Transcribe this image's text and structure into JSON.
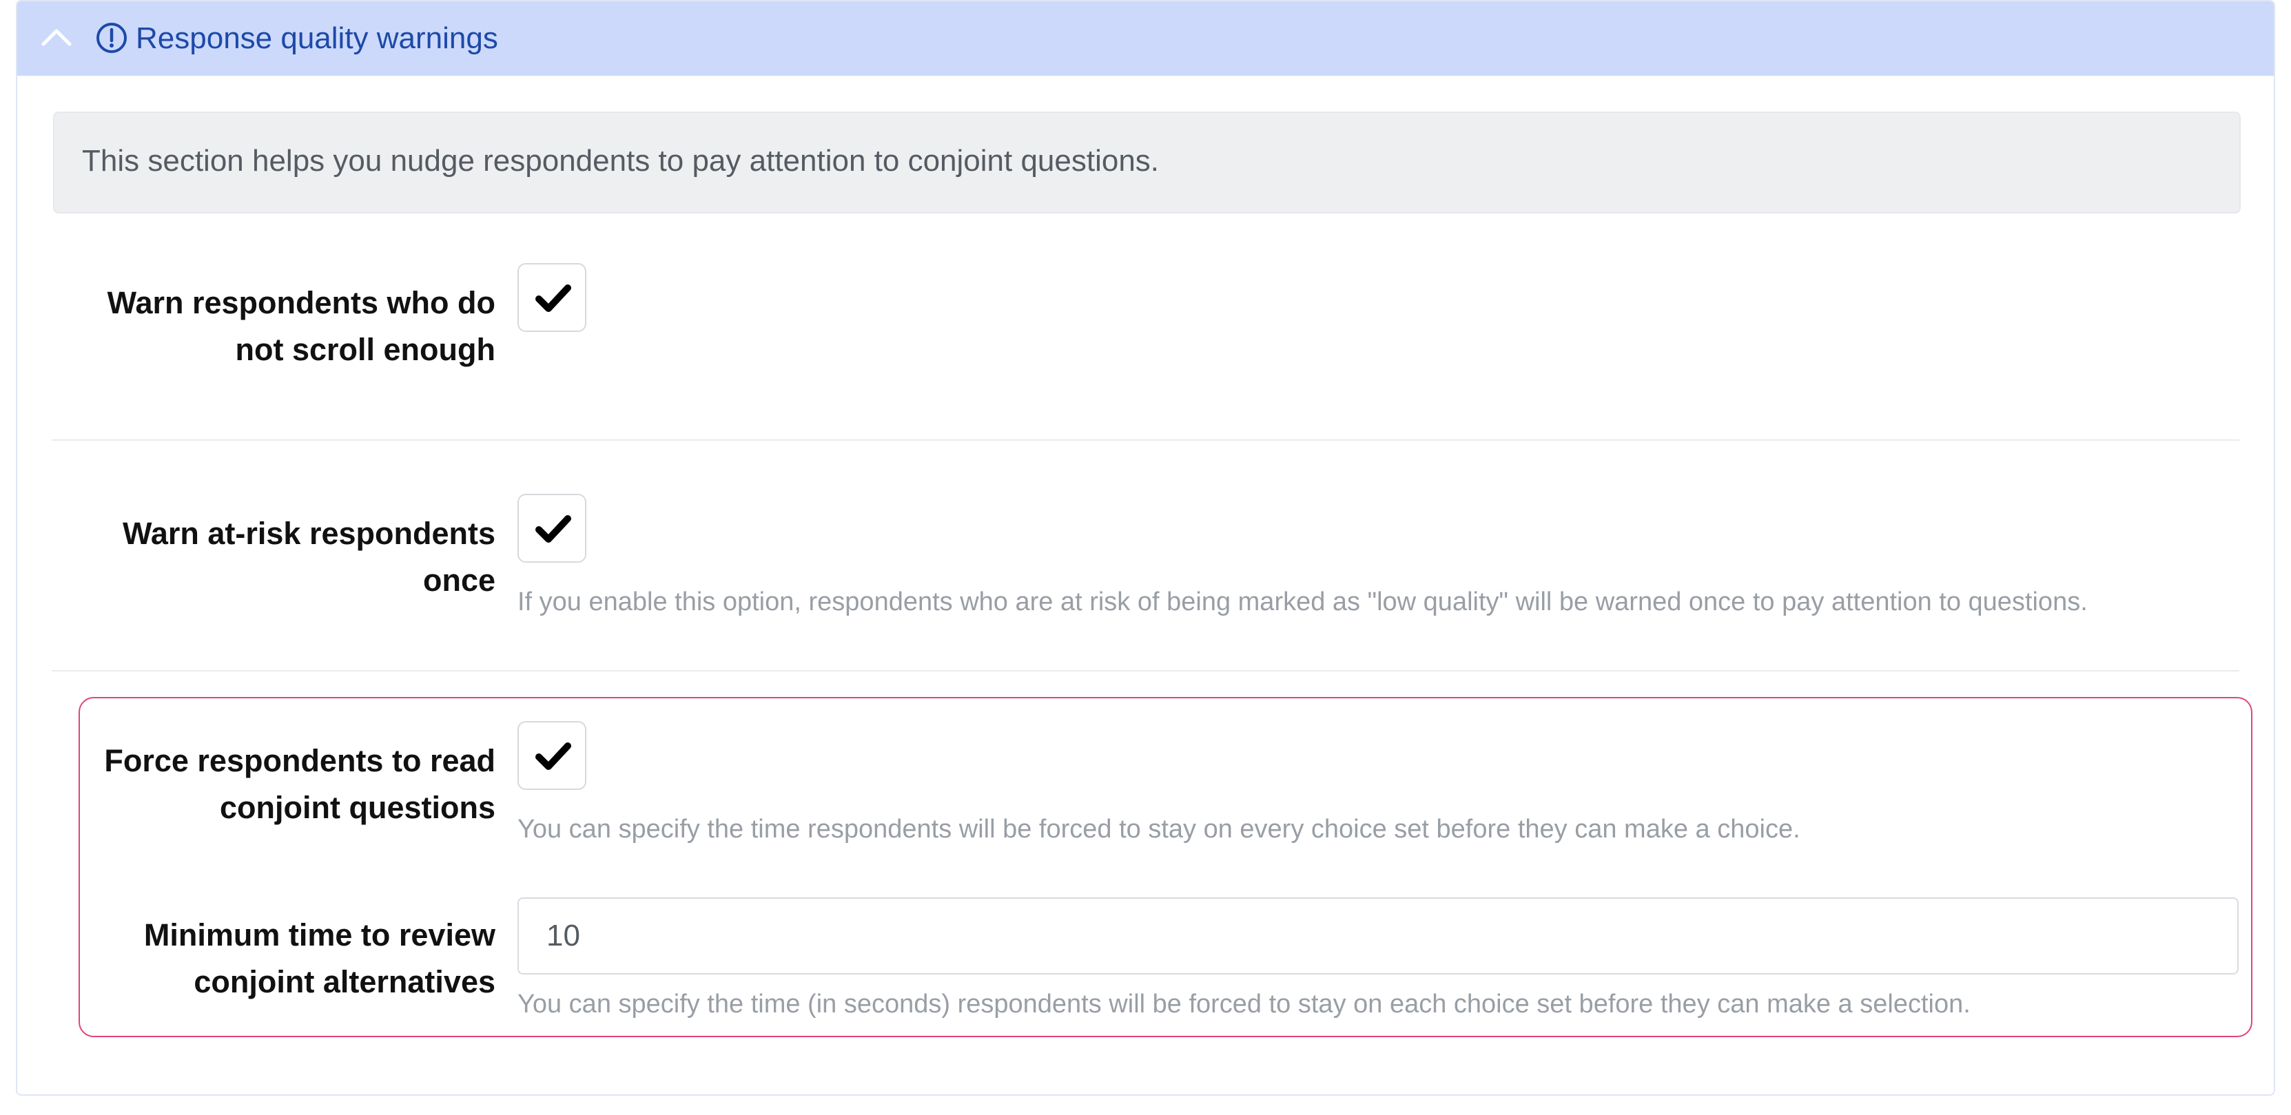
{
  "header": {
    "title": "Response quality warnings",
    "header_color": "#ccd9fb",
    "title_color": "#1d49a8",
    "expanded": true
  },
  "info": {
    "text": "This section helps you nudge respondents to pay attention to conjoint questions."
  },
  "settings": {
    "scroll_warning": {
      "label_line1": "Warn respondents who do",
      "label_line2": "not scroll enough",
      "checked": true
    },
    "at_risk_warning": {
      "label_line1": "Warn at-risk respondents",
      "label_line2": "once",
      "checked": true,
      "help": "If you enable this option, respondents who are at risk of being marked as \"low quality\" will be warned once to pay attention to questions."
    },
    "force_read": {
      "label_line1": "Force respondents to read",
      "label_line2": "conjoint questions",
      "checked": true,
      "help": "You can specify the time respondents will be forced to stay on every choice set before they can make a choice."
    },
    "min_review_time": {
      "label_line1": "Minimum time to review",
      "label_line2": "conjoint alternatives",
      "value": "10",
      "help": "You can specify the time (in seconds) respondents will be forced to stay on each choice set before they can make a selection."
    }
  },
  "icons": {
    "collapse": "chevron-up-icon",
    "alert": "alert-circle-icon",
    "check": "checkmark-icon"
  },
  "colors": {
    "highlight_border": "#e0457a"
  }
}
